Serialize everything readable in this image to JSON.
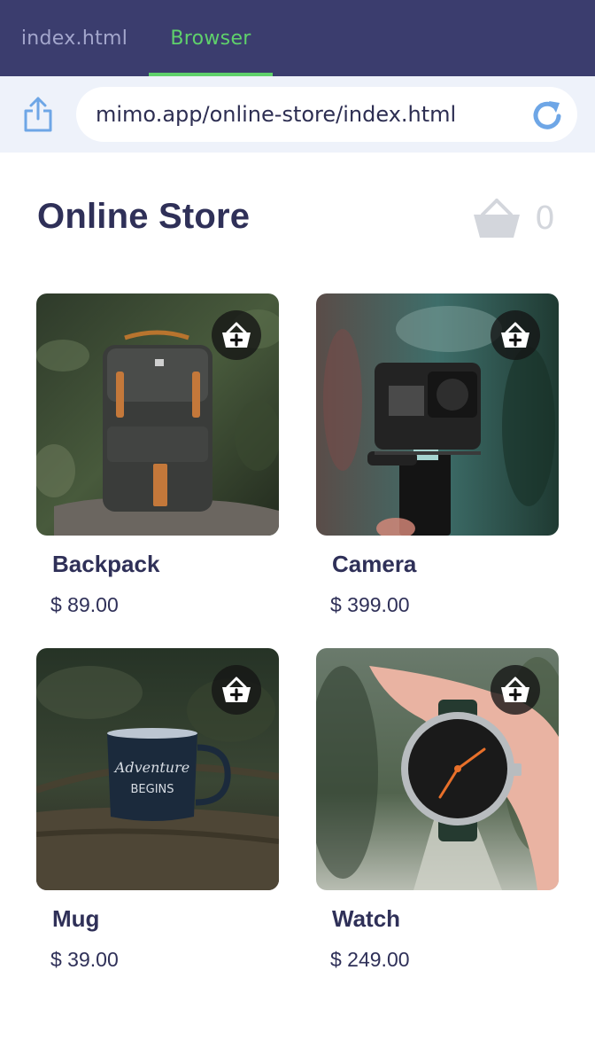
{
  "tabs": [
    {
      "label": "index.html",
      "active": false
    },
    {
      "label": "Browser",
      "active": true
    }
  ],
  "browser": {
    "url": "mimo.app/online-store/index.html"
  },
  "store": {
    "title": "Online Store",
    "cart_count": "0"
  },
  "products": [
    {
      "name": "Backpack",
      "price": "$ 89.00"
    },
    {
      "name": "Camera",
      "price": "$ 399.00"
    },
    {
      "name": "Mug",
      "price": "$ 39.00"
    },
    {
      "name": "Watch",
      "price": "$ 249.00"
    }
  ],
  "icons": {
    "share": "share-icon",
    "reload": "reload-icon",
    "cart": "basket-icon",
    "add_to_cart": "basket-plus-icon"
  },
  "colors": {
    "header_bg": "#3b3d6e",
    "tab_active": "#5fd16b",
    "tab_inactive": "#a3a6cc",
    "address_bg": "#eef2fa",
    "accent_blue": "#6ea6e6",
    "text_dark": "#2f3058"
  }
}
